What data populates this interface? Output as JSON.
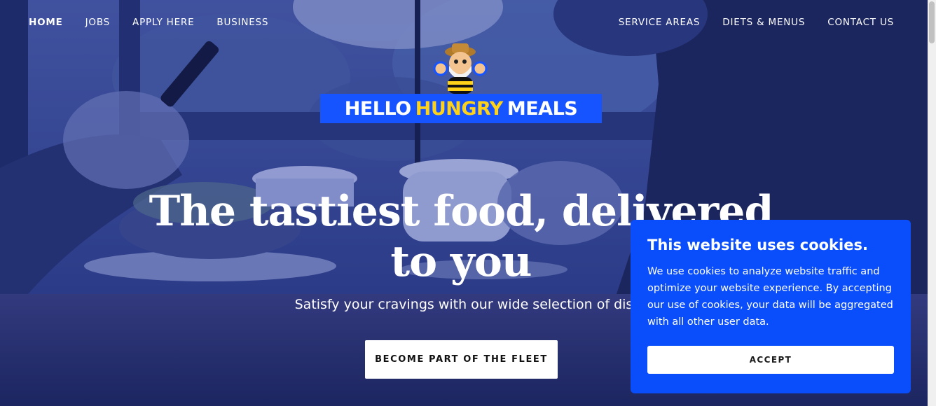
{
  "nav": {
    "left": [
      {
        "label": "HOME",
        "active": true
      },
      {
        "label": "JOBS"
      },
      {
        "label": "APPLY HERE"
      },
      {
        "label": "BUSINESS"
      }
    ],
    "right": [
      {
        "label": "SERVICE AREAS"
      },
      {
        "label": "DIETS & MENUS"
      },
      {
        "label": "CONTACT US"
      }
    ]
  },
  "logo": {
    "word1": "HELLO",
    "word2": "HUNGRY",
    "word3": "MEALS",
    "band_color": "#1654ff",
    "accent_color": "#ffd21a",
    "mascot_icon": "cartoon-chef-mascot-icon"
  },
  "hero": {
    "headline_line1": "The tastiest food, delivered",
    "headline_line2": "to you",
    "subheadline": "Satisfy your cravings with our wide selection of dish",
    "cta_label": "BECOME PART OF THE FLEET"
  },
  "cookie_banner": {
    "title": "This website uses cookies.",
    "body": "We use cookies to analyze website traffic and optimize your website experience. By accepting our use of cookies, your data will be aggregated with all other user data.",
    "accept_label": "ACCEPT",
    "background": "#0a4dfa"
  }
}
